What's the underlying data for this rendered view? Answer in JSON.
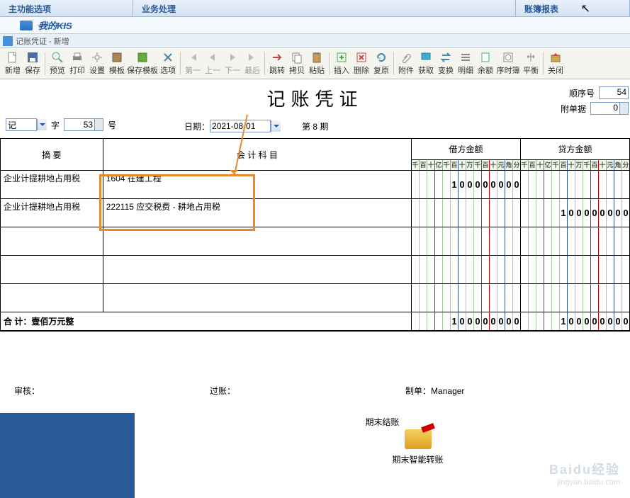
{
  "top_nav": {
    "main": "主功能选项",
    "biz": "业务处理",
    "rep": "账簿报表"
  },
  "kis": "我的KIS",
  "window_title": "记账凭证 - 新增",
  "toolbar": {
    "new": "新增",
    "save": "保存",
    "preview": "预览",
    "print": "打印",
    "settings": "设置",
    "template": "模板",
    "save_template": "保存模板",
    "options": "选项",
    "first": "第一",
    "prev": "上一",
    "next": "下一",
    "last": "最后",
    "jump": "跳转",
    "copy": "拷贝",
    "paste": "粘贴",
    "insert": "插入",
    "delete": "删除",
    "restore": "复原",
    "attach": "附件",
    "fetch": "获取",
    "convert": "变换",
    "detail": "明细",
    "balance": "余额",
    "serial": "序时簿",
    "balance2": "平衡",
    "close": "关闭"
  },
  "voucher": {
    "title": "记账凭证",
    "seq_label": "顺序号",
    "seq_value": "54",
    "attach_label": "附单据",
    "attach_value": "0",
    "type_label": "记",
    "word": "字",
    "number": "53",
    "number_suffix": "号",
    "date_label": "日期：",
    "date_value": "2021-08-01",
    "period": "第 8 期",
    "headers": {
      "summary": "摘  要",
      "account": "会 计 科 目",
      "debit": "借方金额",
      "credit": "贷方金额"
    },
    "digit_labels": [
      "千",
      "百",
      "十",
      "亿",
      "千",
      "百",
      "十",
      "万",
      "千",
      "百",
      "十",
      "元",
      "角",
      "分"
    ],
    "rows": [
      {
        "summary": "企业计提耕地占用税",
        "account": "1604 在建工程",
        "debit": "100000000",
        "credit": ""
      },
      {
        "summary": "企业计提耕地占用税",
        "account": "222115 应交税费 - 耕地占用税",
        "debit": "",
        "credit": "100000000"
      },
      {
        "summary": "",
        "account": "",
        "debit": "",
        "credit": ""
      },
      {
        "summary": "",
        "account": "",
        "debit": "",
        "credit": ""
      },
      {
        "summary": "",
        "account": "",
        "debit": "",
        "credit": ""
      }
    ],
    "total_label": "合  计：",
    "total_words": "壹佰万元整",
    "totals": {
      "debit": "100000000",
      "credit": "100000000"
    },
    "auditor_label": "审核：",
    "poster_label": "过账：",
    "maker_label": "制单：",
    "maker": "Manager"
  },
  "bottom": {
    "period_close": "期末结账",
    "smart_transfer": "期末智能转账"
  },
  "watermark": {
    "brand": "Baidu经验",
    "url": "jingyan.baidu.com"
  }
}
